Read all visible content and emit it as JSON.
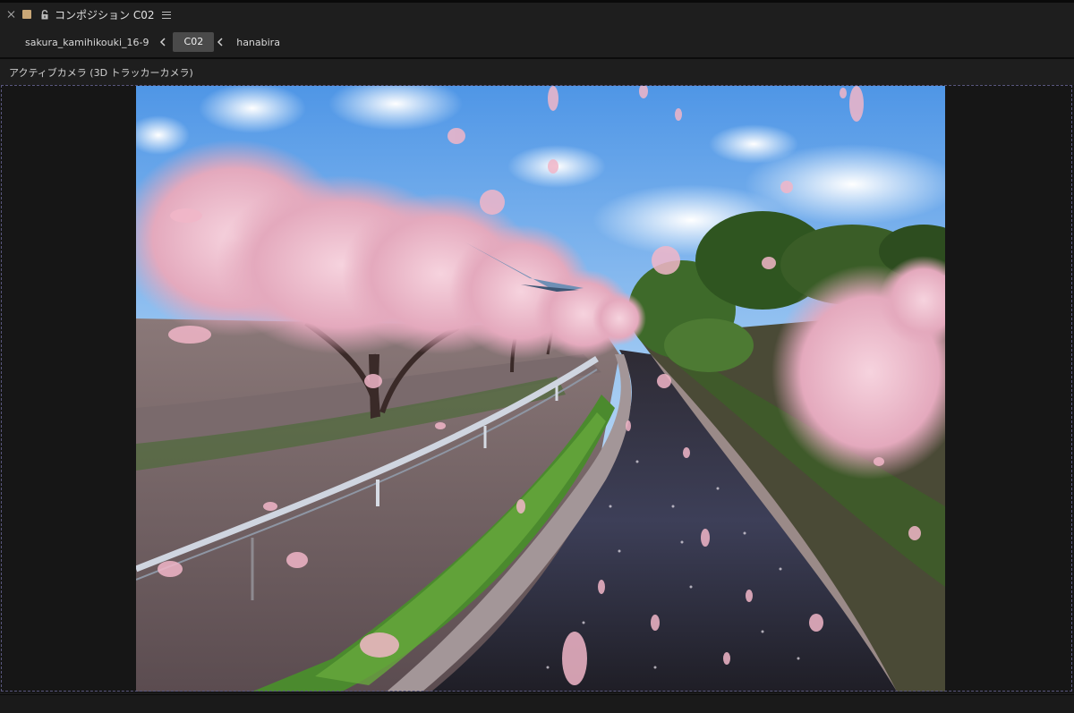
{
  "panel": {
    "title": "コンポジション C02",
    "label_color": "#c9a777"
  },
  "breadcrumb": {
    "items": [
      "sakura_kamihikouki_16-9",
      "C02",
      "hanabira"
    ]
  },
  "viewer": {
    "camera_label": "アクティブカメラ (3D トラッカーカメラ)"
  },
  "colors": {
    "selection_border": "#59577e"
  }
}
